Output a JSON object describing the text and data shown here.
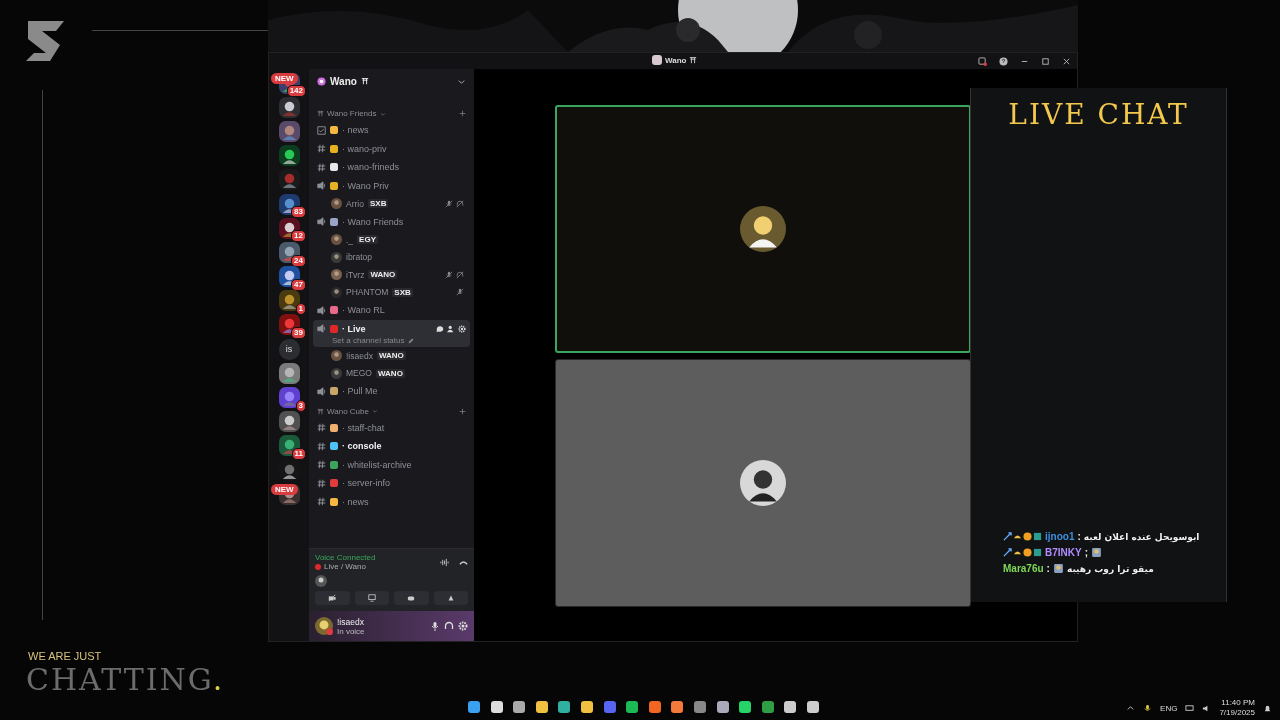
{
  "stream": {
    "tagline": "WE ARE JUST",
    "title": "CHATTING",
    "title_mark": "."
  },
  "window": {
    "title": "Wano"
  },
  "servers": [
    {
      "kind": "picture",
      "new_label": "NEW",
      "count": "142"
    },
    {
      "kind": "picture"
    },
    {
      "kind": "picture"
    },
    {
      "kind": "picture"
    },
    {
      "kind": "picture"
    },
    {
      "kind": "picture",
      "count": "83"
    },
    {
      "kind": "picture",
      "count": "12"
    },
    {
      "kind": "picture",
      "count": "24"
    },
    {
      "kind": "picture",
      "count": "47"
    },
    {
      "kind": "picture",
      "count": "1"
    },
    {
      "kind": "picture",
      "count": "39"
    },
    {
      "kind": "initials",
      "initials": "is"
    },
    {
      "kind": "picture"
    },
    {
      "kind": "picture",
      "count": "3"
    },
    {
      "kind": "picture"
    },
    {
      "kind": "picture",
      "count": "11"
    },
    {
      "kind": "picture"
    },
    {
      "kind": "picture",
      "new_label": "NEW"
    }
  ],
  "server_header": {
    "name": "Wano"
  },
  "categories": [
    {
      "name": "Wano Friends",
      "channels": [
        {
          "kind": "announce",
          "color": "#f5b942",
          "name": "· news",
          "selected": false,
          "unread": false
        },
        {
          "kind": "text",
          "color": "#e6b422",
          "name": "· wano-priv",
          "selected": false,
          "unread": false
        },
        {
          "kind": "text",
          "color": "#e8e8e8",
          "name": "· wano-frineds",
          "selected": false,
          "unread": false
        },
        {
          "kind": "voice",
          "color": "#e6b422",
          "name": "· Wano Priv",
          "selected": false,
          "unread": false,
          "members": [
            {
              "name": "Arrio",
              "tag": "SXB",
              "muted": true,
              "deafened": true
            }
          ]
        },
        {
          "kind": "voice",
          "color": "#9aa4c6",
          "name": "· Wano Friends",
          "selected": false,
          "unread": false,
          "members": [
            {
              "name": "._",
              "tag": "EGY",
              "muted": false,
              "deafened": false
            },
            {
              "name": "ibratop",
              "muted": false,
              "deafened": false
            },
            {
              "name": "iTvrz",
              "tag": "WANO",
              "muted": true,
              "deafened": true
            },
            {
              "name": "PHANTOM",
              "tag": "SXB",
              "muted": true,
              "deafened": false
            }
          ]
        },
        {
          "kind": "voice",
          "color": "#e86a8a",
          "name": "· Wano RL",
          "selected": false,
          "unread": false
        },
        {
          "kind": "voice",
          "color": "#e02828",
          "name": "· Live",
          "selected": true,
          "unread": true,
          "status": "Set a channel status",
          "members": [
            {
              "name": "!isaedx",
              "tag": "WANO",
              "muted": false,
              "deafened": false
            },
            {
              "name": "MEGO",
              "tag": "WANO",
              "muted": false,
              "deafened": false
            }
          ]
        },
        {
          "kind": "voice",
          "color": "#c9a56a",
          "name": "· Pull Me",
          "selected": false,
          "unread": false
        }
      ]
    },
    {
      "name": "Wano Cube",
      "channels": [
        {
          "kind": "text",
          "color": "#f0b070",
          "name": "· staff-chat",
          "selected": false,
          "unread": false
        },
        {
          "kind": "text",
          "color": "#4fc3f7",
          "name": "· console",
          "selected": false,
          "unread": true
        },
        {
          "kind": "text",
          "color": "#3ba55c",
          "name": "· whitelist-archive",
          "selected": false,
          "unread": false
        },
        {
          "kind": "text",
          "color": "#e03c3c",
          "name": "· server-info",
          "selected": false,
          "unread": false
        },
        {
          "kind": "text",
          "color": "#f5b942",
          "name": "· news",
          "selected": false,
          "unread": false
        }
      ]
    }
  ],
  "voice_panel": {
    "status": "Voice Connected",
    "channel": "Live / Wano"
  },
  "user": {
    "name": "!isaedx",
    "status": "In voice"
  },
  "tiles": [
    {
      "speaking": true,
      "color": "#100f0b"
    },
    {
      "speaking": false,
      "color": "#5e5d5d"
    }
  ],
  "live_chat": {
    "title": "LIVE CHAT",
    "messages": [
      {
        "user": "ijnoo1",
        "sep": ":",
        "text": "ابوسويحل عنده اعلان لعبه",
        "color": "#3d8fe0",
        "badges": true,
        "emoji": false
      },
      {
        "user": "B7INKY",
        "sep": ";",
        "color": "#b08cff",
        "badges": true,
        "emoji": true
      },
      {
        "user": "Mara76u",
        "sep": ":",
        "text": "ميقو ترا روب رهيبه",
        "color": "#7ed957",
        "badges": false,
        "emoji": true
      }
    ]
  },
  "taskbar": {
    "language": "ENG",
    "time": "11:40 PM",
    "date": "7/19/2025"
  }
}
